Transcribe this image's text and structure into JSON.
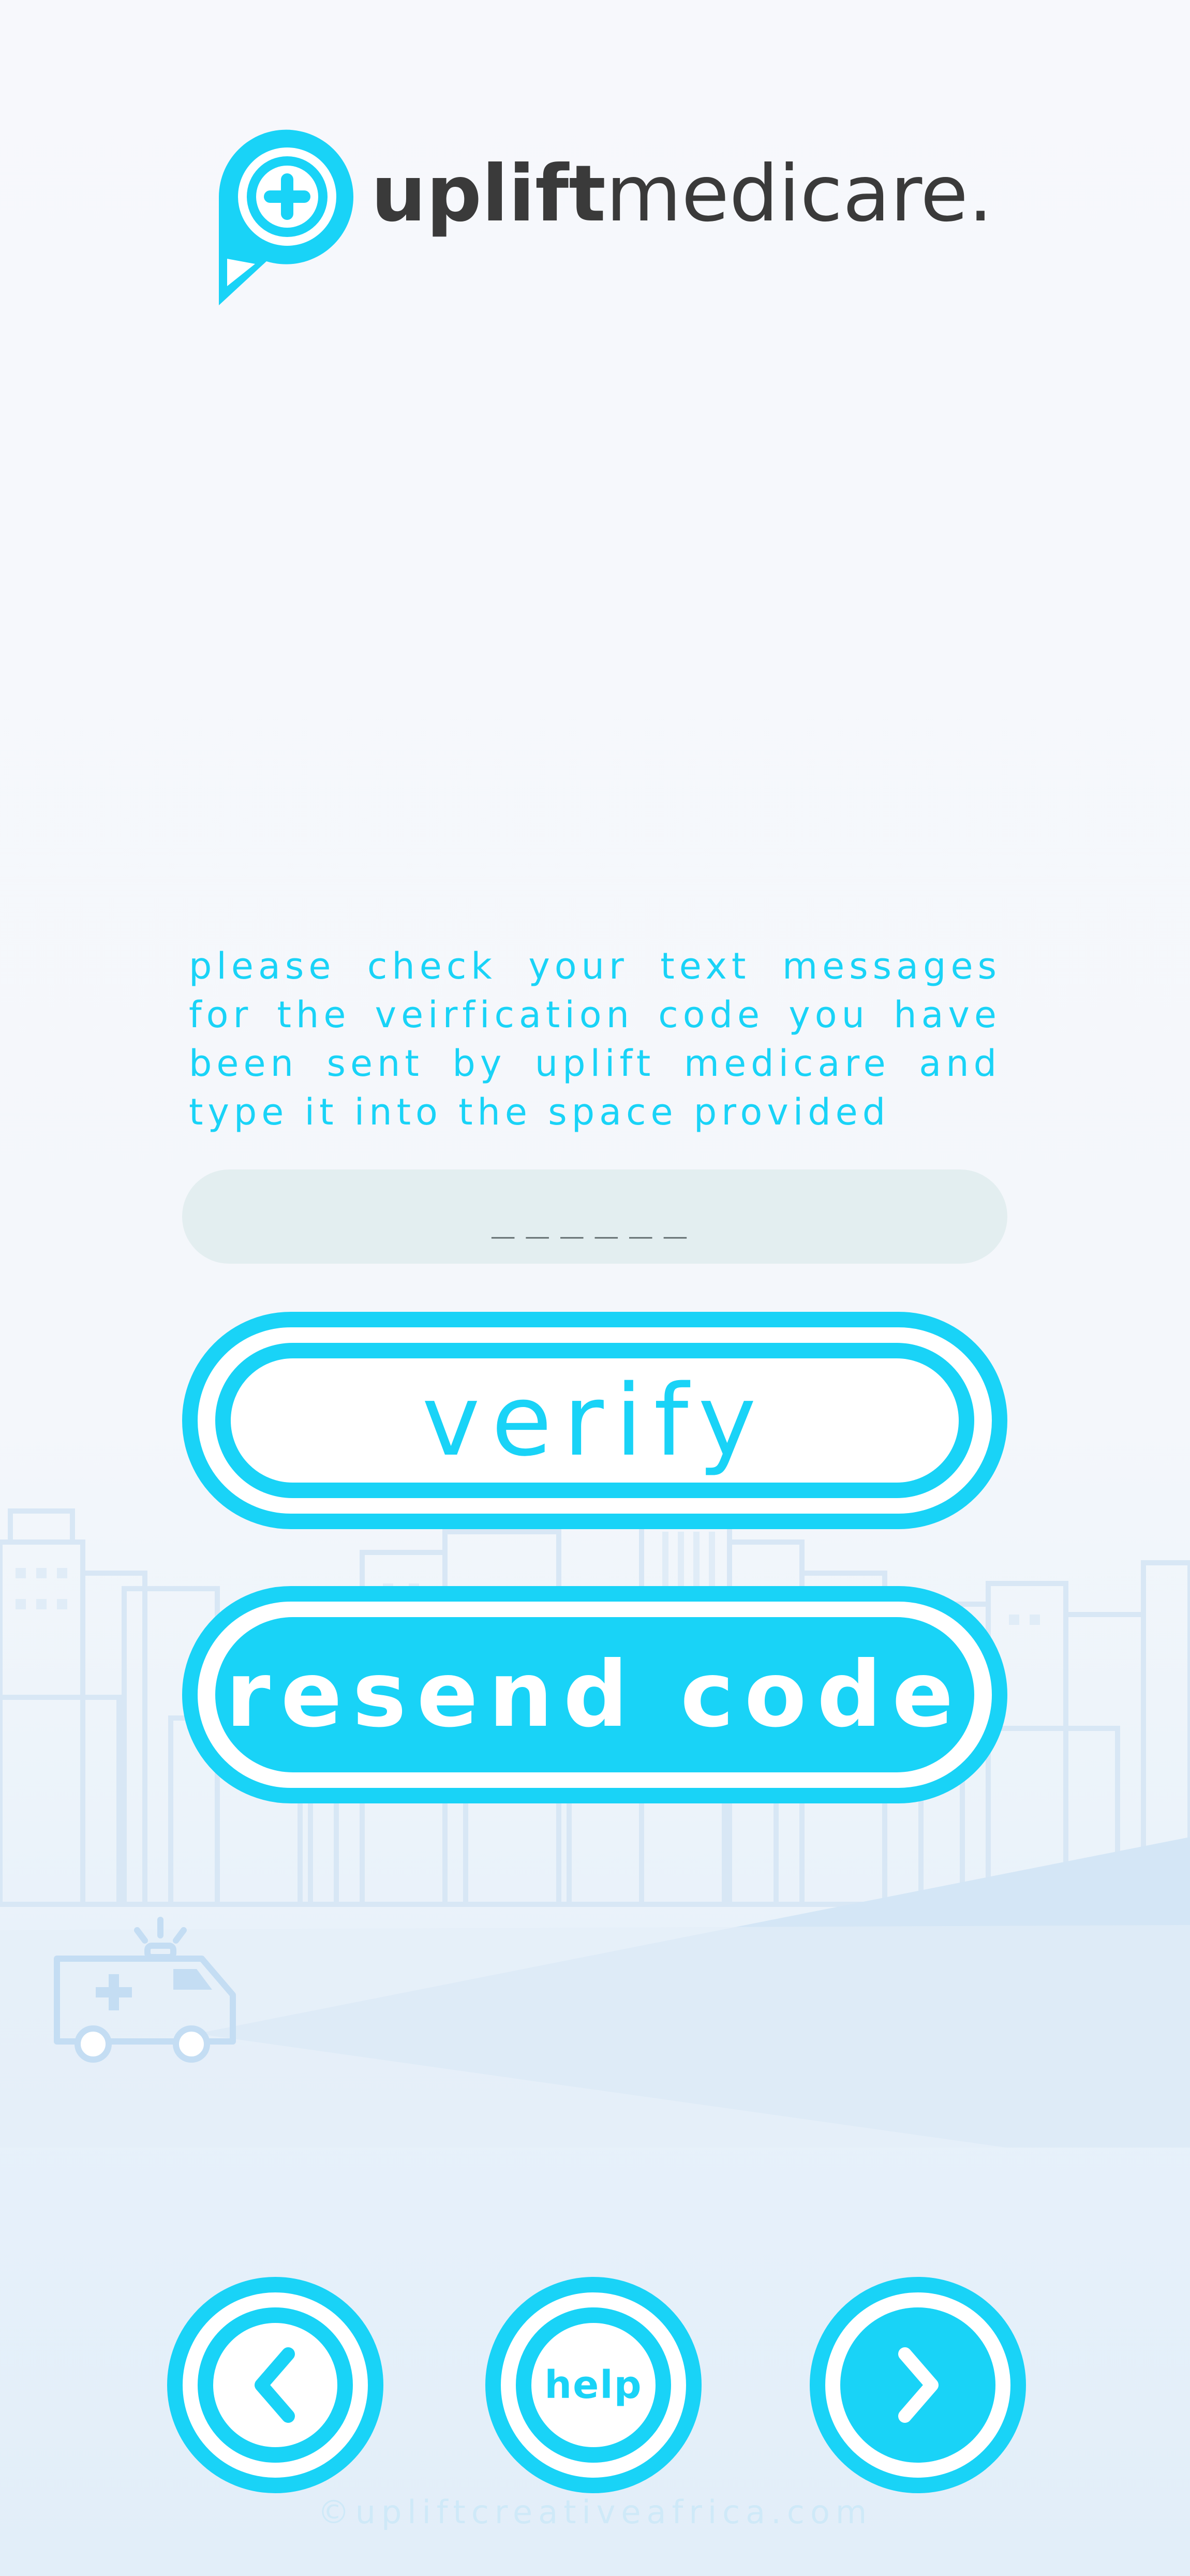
{
  "brand": {
    "name_strong": "uplift",
    "name_light": "medicare."
  },
  "instructions": "please check your text messages for the veirfication code you have been sent by uplift medicare and type it into the space provided",
  "code_input": {
    "placeholder": "______",
    "value": ""
  },
  "buttons": {
    "verify": "verify",
    "resend": "resend code",
    "help": "help"
  },
  "nav": {
    "back_icon": "chevron-left-icon",
    "next_icon": "chevron-right-icon"
  },
  "footer": "©upliftcreativeafrica.com",
  "colors": {
    "accent": "#19d3f7",
    "text_dark": "#3a3a3a",
    "input_bg": "#e3eef0",
    "skyline": "#d4e6f6"
  }
}
